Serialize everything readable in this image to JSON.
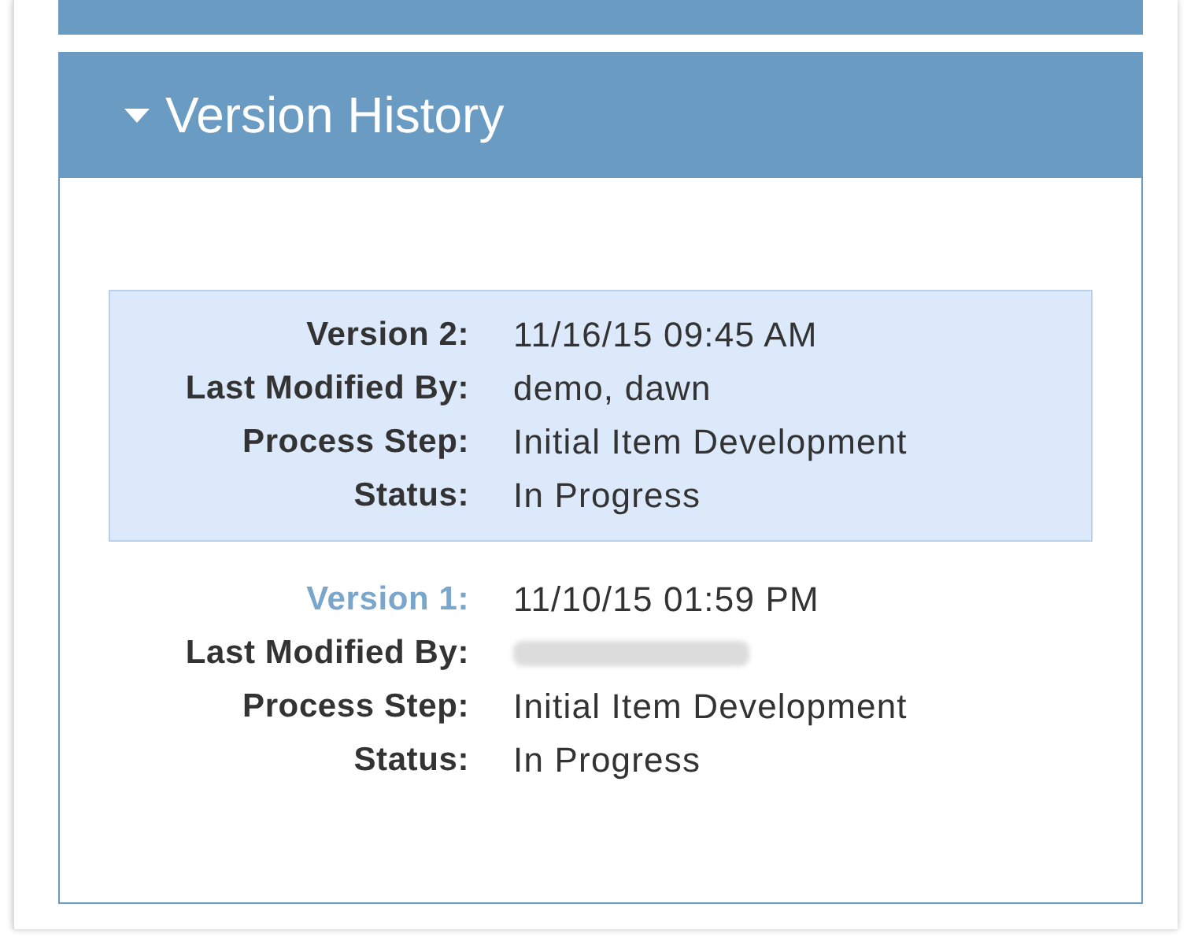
{
  "panel": {
    "title": "Version History",
    "expanded": true
  },
  "versions": [
    {
      "selected": true,
      "fields": [
        {
          "label": "Version 2:",
          "value": "11/16/15 09:45 AM"
        },
        {
          "label": "Last Modified By:",
          "value": "demo, dawn"
        },
        {
          "label": "Process Step:",
          "value": "Initial Item Development"
        },
        {
          "label": "Status:",
          "value": "In Progress"
        }
      ]
    },
    {
      "selected": false,
      "fields": [
        {
          "label": "Version 1:",
          "value": "11/10/15 01:59 PM"
        },
        {
          "label": "Last Modified By:",
          "redacted": true
        },
        {
          "label": "Process Step:",
          "value": "Initial Item Development"
        },
        {
          "label": "Status:",
          "value": "In Progress"
        }
      ]
    }
  ]
}
